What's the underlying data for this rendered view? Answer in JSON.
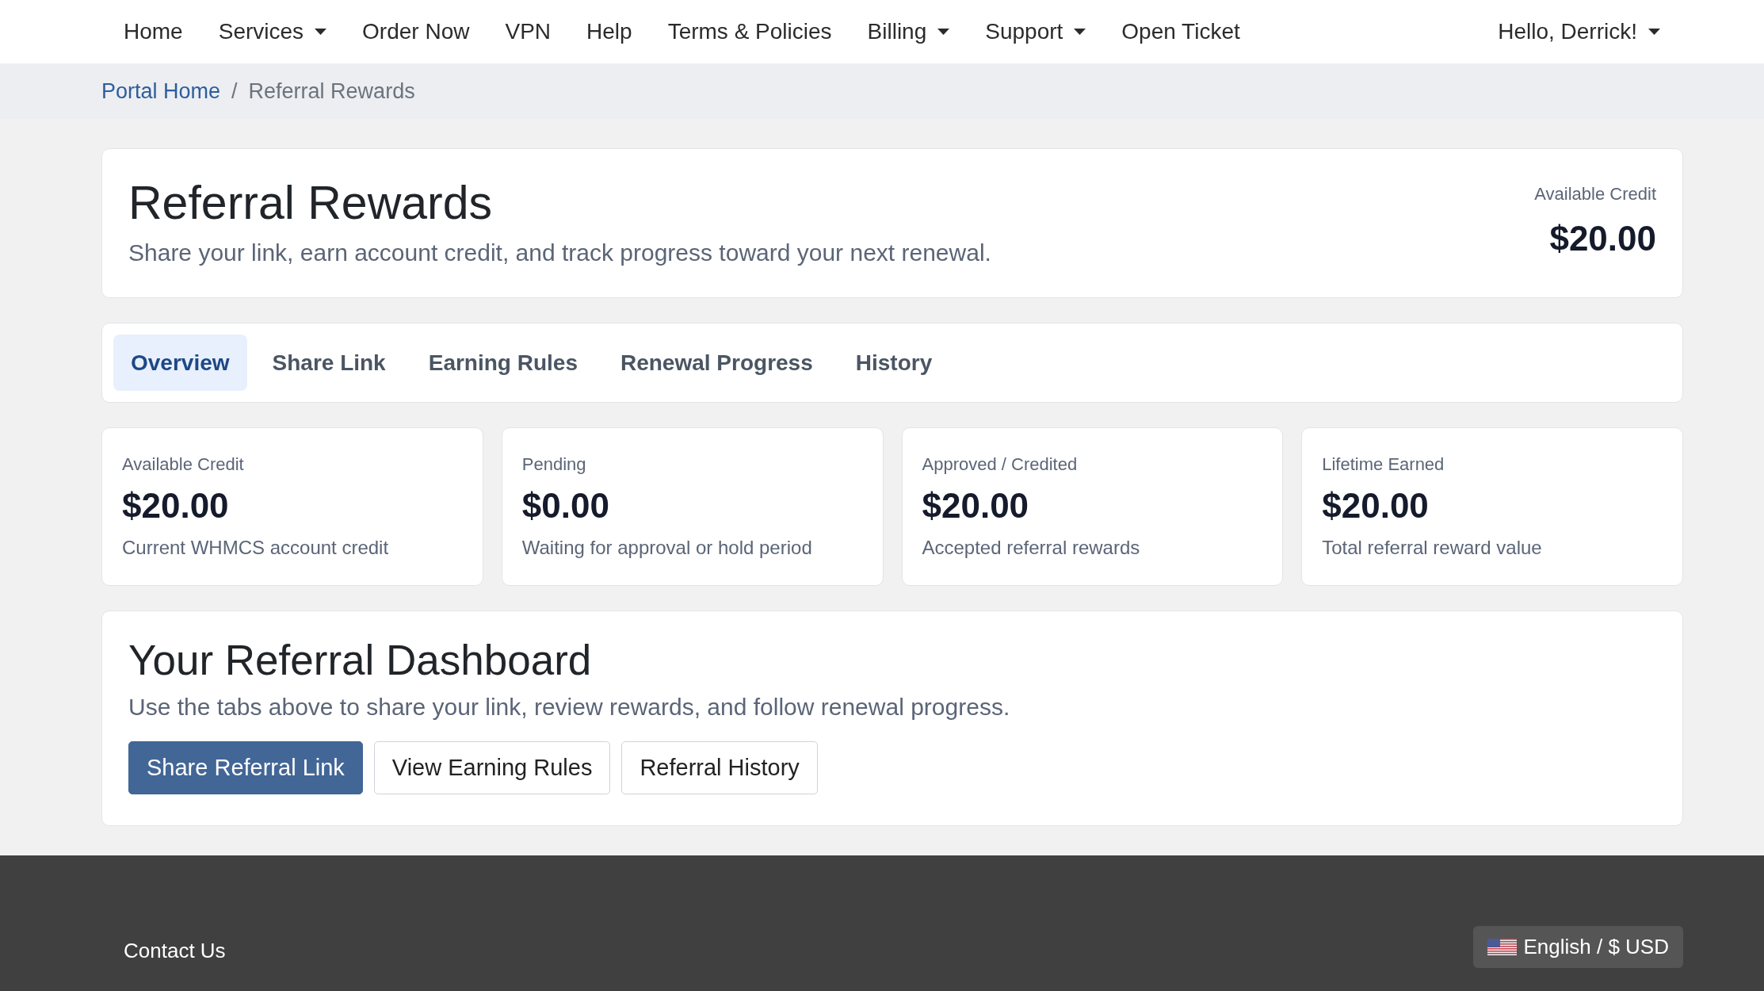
{
  "nav": {
    "items": [
      {
        "label": "Home",
        "dropdown": false
      },
      {
        "label": "Services",
        "dropdown": true
      },
      {
        "label": "Order Now",
        "dropdown": false
      },
      {
        "label": "VPN",
        "dropdown": false
      },
      {
        "label": "Help",
        "dropdown": false
      },
      {
        "label": "Terms & Policies",
        "dropdown": false
      },
      {
        "label": "Billing",
        "dropdown": true
      },
      {
        "label": "Support",
        "dropdown": true
      },
      {
        "label": "Open Ticket",
        "dropdown": false
      }
    ],
    "user_menu": {
      "label": "Hello, Derrick!",
      "dropdown": true
    }
  },
  "breadcrumb": {
    "separator": "/",
    "items": [
      {
        "label": "Portal Home",
        "kind": "link"
      },
      {
        "label": "Referral Rewards",
        "kind": "current"
      }
    ]
  },
  "header": {
    "title": "Referral Rewards",
    "subtitle": "Share your link, earn account credit, and track progress toward your next renewal.",
    "credit_label": "Available Credit",
    "credit_value": "$20.00"
  },
  "tabs": [
    {
      "label": "Overview",
      "selected": true
    },
    {
      "label": "Share Link",
      "selected": false
    },
    {
      "label": "Earning Rules",
      "selected": false
    },
    {
      "label": "Renewal Progress",
      "selected": false
    },
    {
      "label": "History",
      "selected": false
    }
  ],
  "stats": [
    {
      "label": "Available Credit",
      "value": "$20.00",
      "note": "Current WHMCS account credit"
    },
    {
      "label": "Pending",
      "value": "$0.00",
      "note": "Waiting for approval or hold period"
    },
    {
      "label": "Approved / Credited",
      "value": "$20.00",
      "note": "Accepted referral rewards"
    },
    {
      "label": "Lifetime Earned",
      "value": "$20.00",
      "note": "Total referral reward value"
    }
  ],
  "dashboard": {
    "title": "Your Referral Dashboard",
    "text": "Use the tabs above to share your link, review rewards, and follow renewal progress.",
    "buttons": [
      {
        "label": "Share Referral Link",
        "kind": "primary"
      },
      {
        "label": "View Earning Rules",
        "kind": "outline"
      },
      {
        "label": "Referral History",
        "kind": "outline"
      }
    ]
  },
  "footer": {
    "link": "Contact Us",
    "language": "English / $ USD"
  }
}
